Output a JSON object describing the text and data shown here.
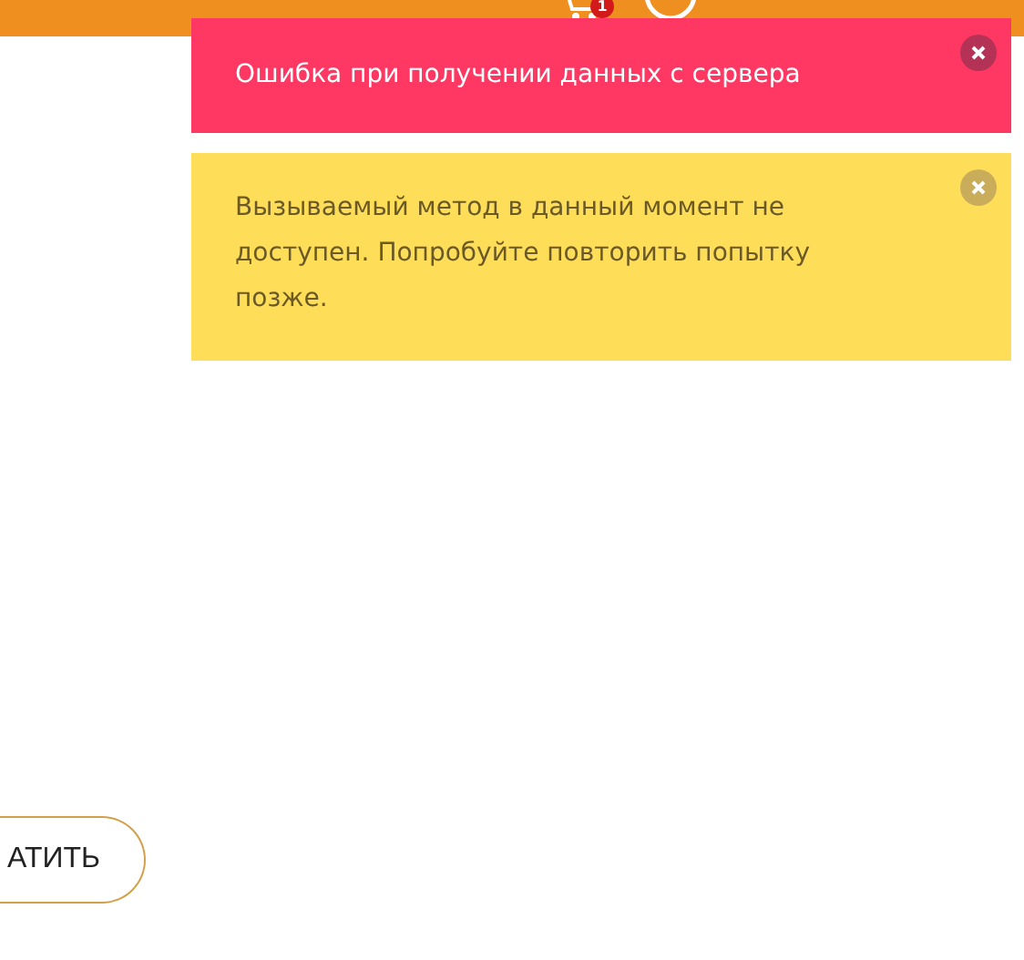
{
  "header": {
    "cart_badge": "1"
  },
  "toasts": [
    {
      "kind": "error",
      "message": "Ошибка при получении данных с сервера"
    },
    {
      "kind": "warning",
      "message": "Вызываемый метод в данный момент не доступен. Попробуйте повторить попытку позже."
    }
  ],
  "button": {
    "label": "АТИТЬ"
  }
}
